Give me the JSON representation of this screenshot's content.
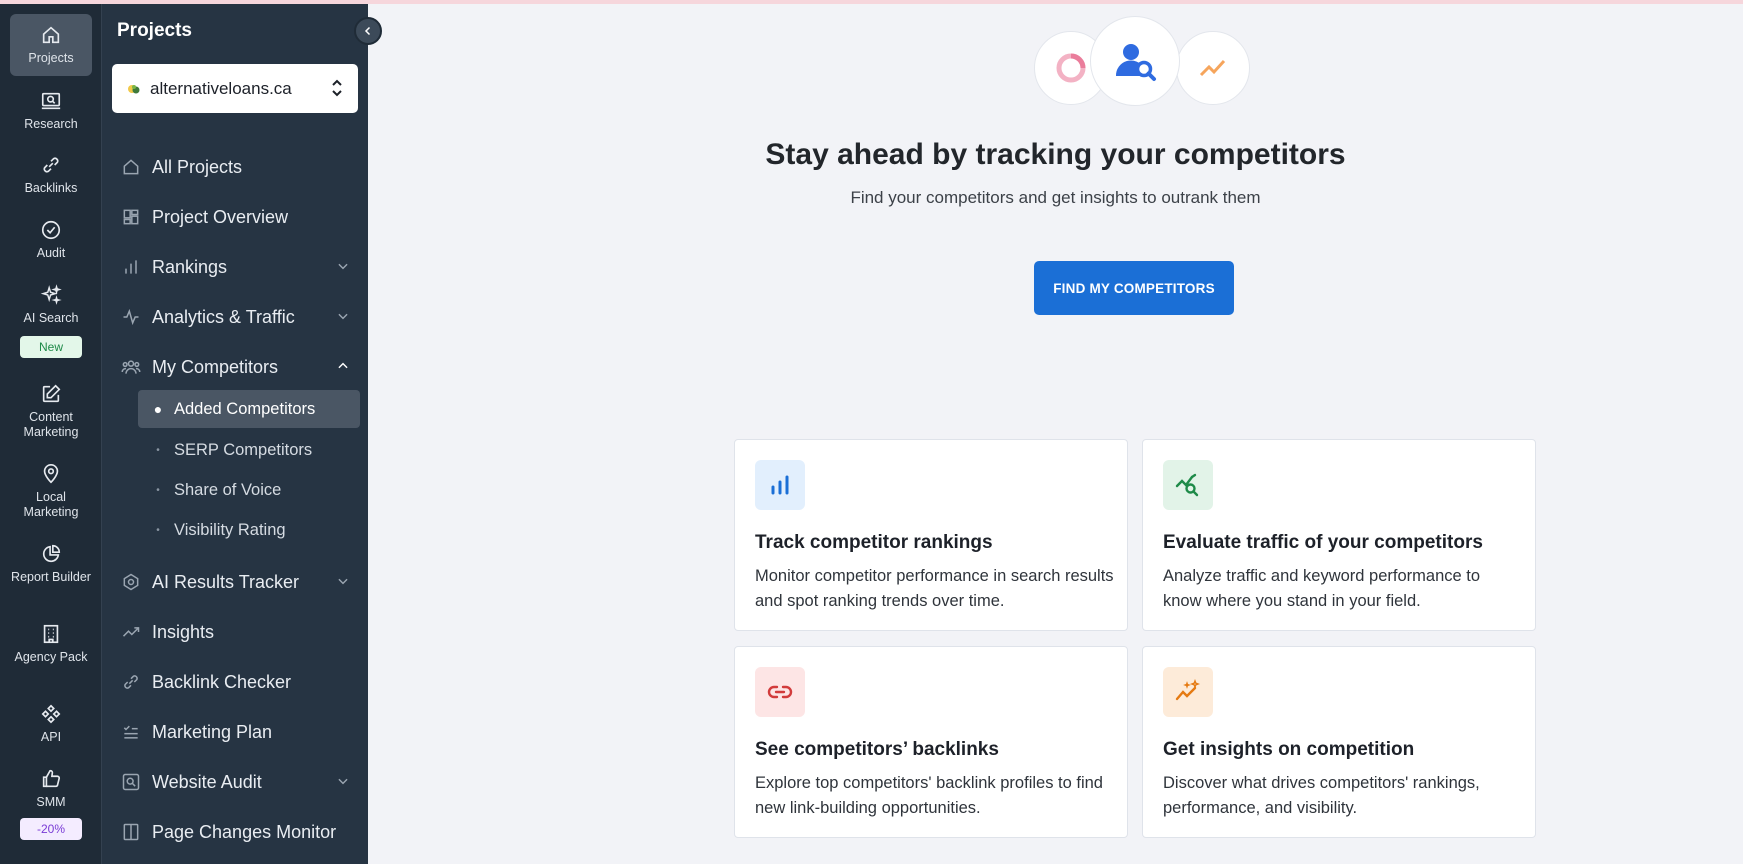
{
  "rail": {
    "items": [
      {
        "label": "Projects",
        "icon": "home-icon"
      },
      {
        "label": "Research",
        "icon": "research-icon"
      },
      {
        "label": "Backlinks",
        "icon": "link-icon"
      },
      {
        "label": "Audit",
        "icon": "check-circle-icon"
      },
      {
        "label": "AI Search",
        "icon": "sparkle-icon"
      },
      {
        "label": "Content Marketing",
        "icon": "edit-icon"
      },
      {
        "label": "Local Marketing",
        "icon": "map-pin-icon"
      },
      {
        "label": "Report Builder",
        "icon": "pie-chart-icon"
      },
      {
        "label": "Agency Pack",
        "icon": "building-icon"
      },
      {
        "label": "API",
        "icon": "api-icon"
      },
      {
        "label": "SMM",
        "icon": "thumbs-up-icon"
      }
    ],
    "badge_new": "New",
    "badge_discount": "-20%"
  },
  "nav": {
    "title": "Projects",
    "project": "alternativeloans.ca",
    "items": [
      {
        "label": "All Projects"
      },
      {
        "label": "Project Overview"
      },
      {
        "label": "Rankings"
      },
      {
        "label": "Analytics & Traffic"
      },
      {
        "label": "My Competitors"
      },
      {
        "label": "AI Results Tracker"
      },
      {
        "label": "Insights"
      },
      {
        "label": "Backlink Checker"
      },
      {
        "label": "Marketing Plan"
      },
      {
        "label": "Website Audit"
      },
      {
        "label": "Page Changes Monitor"
      }
    ],
    "sub_items": [
      {
        "label": "Added Competitors"
      },
      {
        "label": "SERP Competitors"
      },
      {
        "label": "Share of Voice"
      },
      {
        "label": "Visibility Rating"
      }
    ]
  },
  "main": {
    "headline": "Stay ahead by tracking your competitors",
    "subline": "Find your competitors and get insights to outrank them",
    "cta": "FIND MY COMPETITORS",
    "cards": [
      {
        "title": "Track competitor rankings",
        "desc": "Monitor competitor performance in search results and spot ranking trends over time."
      },
      {
        "title": "Evaluate traffic of your competitors",
        "desc": "Analyze traffic and keyword performance to know where you stand in your field."
      },
      {
        "title": "See competitors’ backlinks",
        "desc": "Explore top competitors' backlink profiles to find new link-building opportunities."
      },
      {
        "title": "Get insights on competition",
        "desc": "Discover what drives competitors' rankings, performance, and visibility."
      }
    ]
  },
  "colors": {
    "rail_bg": "#1f2b37",
    "nav_bg": "#263443",
    "accent": "#1b6fd6",
    "page_bg": "#f2f3f7"
  }
}
